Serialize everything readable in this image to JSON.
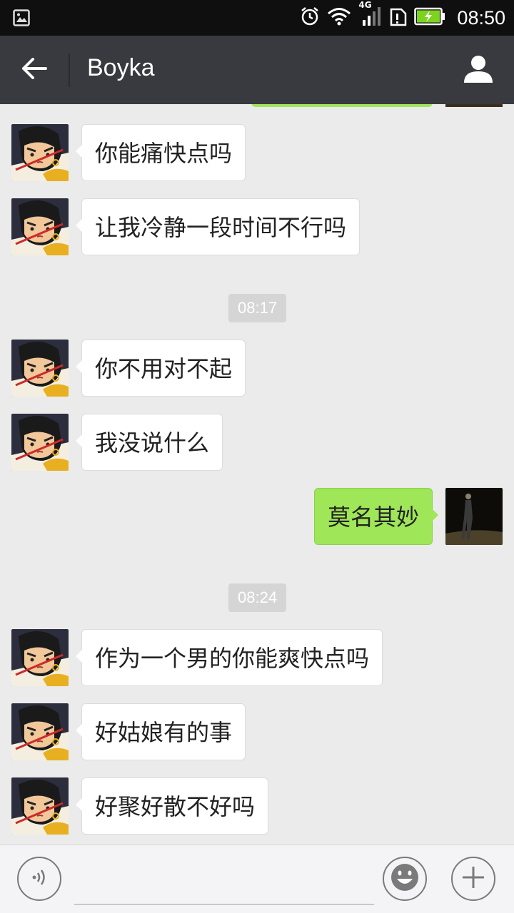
{
  "status_bar": {
    "time": "08:50",
    "network": "4G",
    "icons": [
      "gallery-icon",
      "alarm-icon",
      "wifi-icon",
      "signal-icon",
      "sim-icon",
      "battery-charging-icon"
    ],
    "battery_color": "#7ed321"
  },
  "header": {
    "title": "Boyka",
    "back_icon": "back-arrow-icon",
    "profile_icon": "person-icon"
  },
  "colors": {
    "received_bubble": "#ffffff",
    "sent_bubble": "#9fe658",
    "background": "#ebebeb",
    "titlebar": "#393a3f"
  },
  "messages": [
    {
      "type": "received",
      "text": "你能痛快点吗"
    },
    {
      "type": "received",
      "text": "让我冷静一段时间不行吗"
    },
    {
      "type": "time",
      "text": "08:17"
    },
    {
      "type": "received",
      "text": "你不用对不起"
    },
    {
      "type": "received",
      "text": "我没说什么"
    },
    {
      "type": "sent",
      "text": "莫名其妙"
    },
    {
      "type": "time",
      "text": "08:24"
    },
    {
      "type": "received",
      "text": "作为一个男的你能爽快点吗"
    },
    {
      "type": "received",
      "text": "好姑娘有的事"
    },
    {
      "type": "received",
      "text": "好聚好散不好吗"
    }
  ],
  "input_bar": {
    "voice_icon": "voice-icon",
    "emoji_icon": "emoji-icon",
    "plus_icon": "plus-icon",
    "placeholder": ""
  }
}
